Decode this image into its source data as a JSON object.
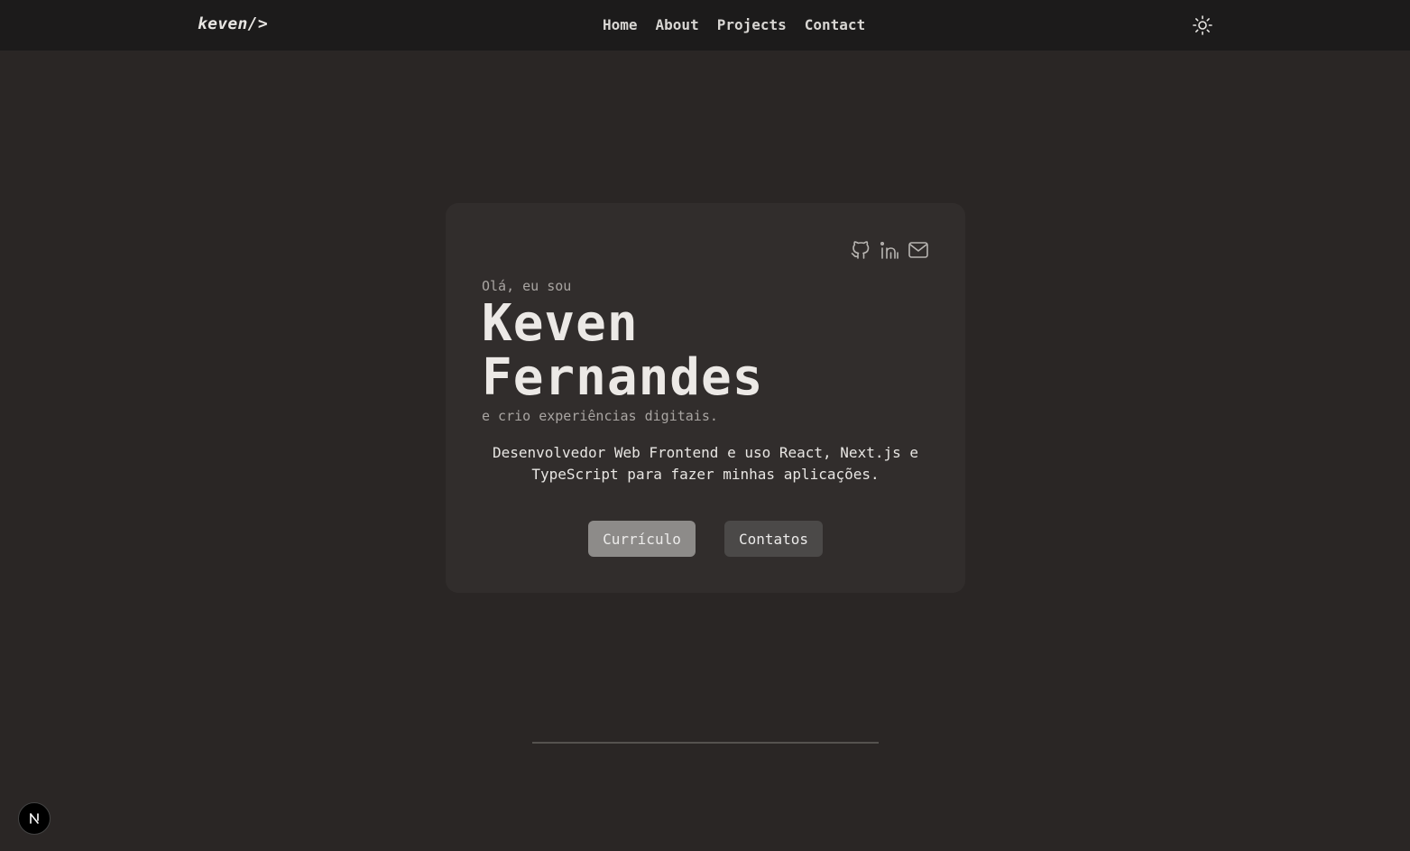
{
  "navbar": {
    "logo": "keven/>",
    "links": [
      "Home",
      "About",
      "Projects",
      "Contact"
    ],
    "theme_icon": "sun-icon"
  },
  "hero": {
    "greeting": "Olá, eu sou",
    "name_line1": "Keven",
    "name_line2": "Fernandes",
    "tagline": "e crio experiências digitais.",
    "description": "Desenvolvedor Web Frontend e uso React, Next.js e TypeScript para fazer minhas aplicações.",
    "buttons": {
      "cv_label": "Currículo",
      "contact_label": "Contatos"
    },
    "socials": [
      "github-icon",
      "linkedin-icon",
      "mail-icon"
    ]
  },
  "badge": {
    "letter": "N"
  },
  "colors": {
    "background": "#2a2625",
    "navbar": "#1c1b1b",
    "card": "#312d2c",
    "primary_button": "#8d8b89",
    "secondary_button": "#4b4948"
  }
}
